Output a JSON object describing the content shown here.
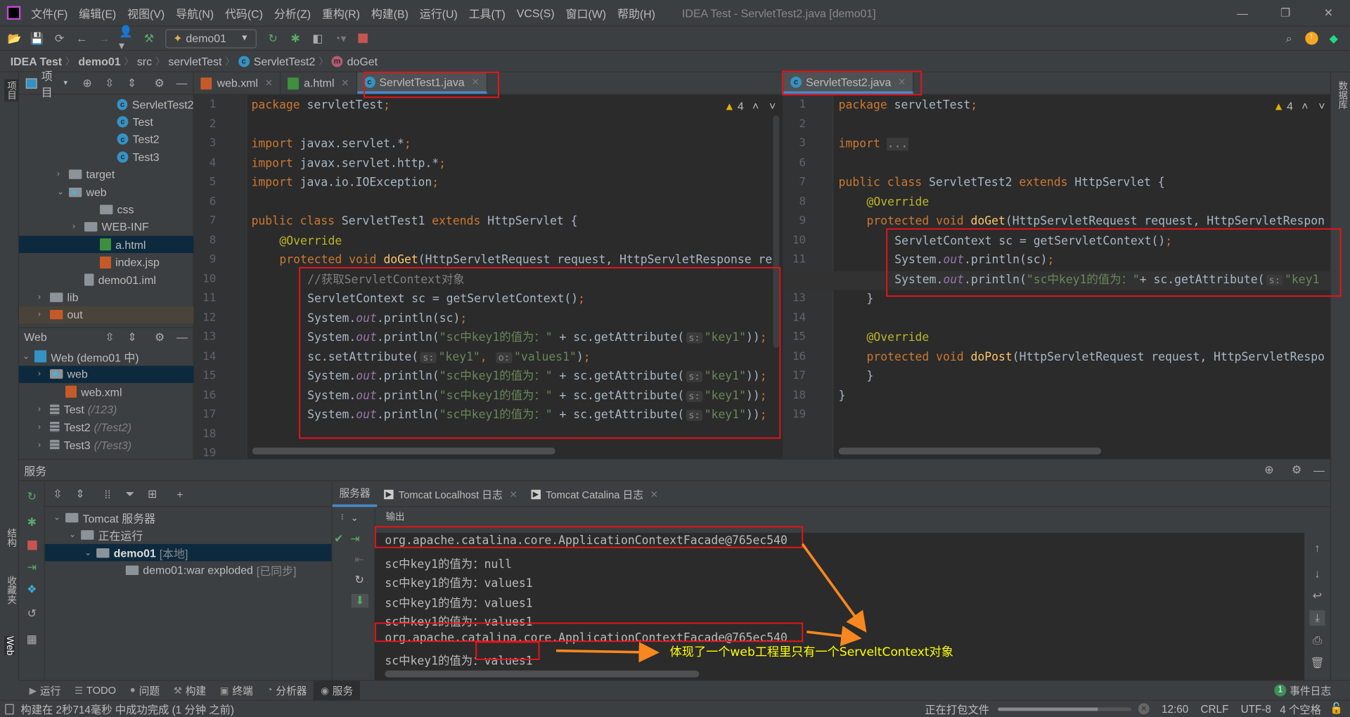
{
  "menu": [
    "文件(F)",
    "编辑(E)",
    "视图(V)",
    "导航(N)",
    "代码(C)",
    "分析(Z)",
    "重构(R)",
    "构建(B)",
    "运行(U)",
    "工具(T)",
    "VCS(S)",
    "窗口(W)",
    "帮助(H)"
  ],
  "window_title": "IDEA Test - ServletTest2.java [demo01]",
  "toolbar": {
    "run_config": "demo01"
  },
  "breadcrumb": [
    "IDEA Test",
    "demo01",
    "src",
    "servletTest",
    "ServletTest2",
    "doGet"
  ],
  "left_strip": {
    "project": "项目",
    "structure": "结构",
    "favorites": "收藏夹",
    "web": "Web"
  },
  "right_strip": {
    "database": "数据库"
  },
  "project_panel": {
    "title": "项目",
    "items": [
      {
        "label": "ServletTest2",
        "icon": "class-icon",
        "indent": 100
      },
      {
        "label": "Test",
        "icon": "class-icon",
        "indent": 100
      },
      {
        "label": "Test2",
        "icon": "class-icon",
        "indent": 100
      },
      {
        "label": "Test3",
        "icon": "class-icon",
        "indent": 100
      },
      {
        "label": "target",
        "icon": "folder-icon",
        "indent": 44,
        "arrow": "›"
      },
      {
        "label": "web",
        "icon": "web-folder-icon",
        "indent": 44,
        "arrow": "⌄"
      },
      {
        "label": "css",
        "icon": "folder-icon",
        "indent": 80
      },
      {
        "label": "WEB-INF",
        "icon": "folder-icon",
        "indent": 62,
        "arrow": "›"
      },
      {
        "label": "a.html",
        "icon": "html-file-icon",
        "indent": 80,
        "selected": true
      },
      {
        "label": "index.jsp",
        "icon": "jsp-file-icon",
        "indent": 80
      },
      {
        "label": "demo01.iml",
        "icon": "iml-file-icon",
        "indent": 62
      },
      {
        "label": "lib",
        "icon": "folder-icon",
        "indent": 22,
        "arrow": "›"
      },
      {
        "label": "out",
        "icon": "orange-folder-icon",
        "indent": 22,
        "arrow": "›",
        "highlight": true
      }
    ]
  },
  "web_panel": {
    "title": "Web",
    "items": [
      {
        "label": "Web (demo01 中)",
        "icon": "web-module-icon",
        "indent": 4,
        "arrow": "⌄"
      },
      {
        "label": "web",
        "icon": "web-folder-icon",
        "indent": 22,
        "arrow": "›",
        "selected": true
      },
      {
        "label": "web.xml",
        "icon": "xml-file-icon",
        "indent": 40
      },
      {
        "label": "Test",
        "hint": "(/123)",
        "icon": "servlet-icon",
        "indent": 22,
        "arrow": "›"
      },
      {
        "label": "Test2",
        "hint": "(/Test2)",
        "icon": "servlet-icon",
        "indent": 22,
        "arrow": "›"
      },
      {
        "label": "Test3",
        "hint": "(/Test3)",
        "icon": "servlet-icon",
        "indent": 22,
        "arrow": "›"
      }
    ]
  },
  "editor1": {
    "tabs": [
      {
        "label": "web.xml"
      },
      {
        "label": "a.html"
      },
      {
        "label": "ServletTest1.java",
        "active": true
      }
    ],
    "warnings": "4",
    "lines": [
      {
        "n": "1",
        "i": 0,
        "t": [
          [
            "package ",
            "kw"
          ],
          [
            "servletTest",
            "pl"
          ],
          [
            ";",
            "kw"
          ]
        ]
      },
      {
        "n": "2",
        "i": 0,
        "t": []
      },
      {
        "n": "3",
        "i": 0,
        "t": [
          [
            "import ",
            "kw"
          ],
          [
            "javax.servlet.*",
            "pl"
          ],
          [
            ";",
            "kw"
          ]
        ]
      },
      {
        "n": "4",
        "i": 0,
        "t": [
          [
            "import ",
            "kw"
          ],
          [
            "javax.servlet.http.*",
            "pl"
          ],
          [
            ";",
            "kw"
          ]
        ]
      },
      {
        "n": "5",
        "i": 0,
        "t": [
          [
            "import ",
            "kw"
          ],
          [
            "java.io.IOException",
            "pl"
          ],
          [
            ";",
            "kw"
          ]
        ]
      },
      {
        "n": "6",
        "i": 0,
        "t": []
      },
      {
        "n": "7",
        "i": 0,
        "t": [
          [
            "public class ",
            "kw"
          ],
          [
            "ServletTest1 ",
            "pl"
          ],
          [
            "extends ",
            "kw"
          ],
          [
            "HttpServlet {",
            "pl"
          ]
        ]
      },
      {
        "n": "8",
        "i": 1,
        "t": [
          [
            "@Override",
            "ann"
          ]
        ]
      },
      {
        "n": "9",
        "i": 1,
        "t": [
          [
            "protected void ",
            "kw"
          ],
          [
            "doGet",
            "mth"
          ],
          [
            "(HttpServletRequest request, HttpServletResponse res",
            "pl"
          ]
        ]
      },
      {
        "n": "10",
        "i": 2,
        "t": [
          [
            "//获取ServletContext对象",
            "cm"
          ]
        ]
      },
      {
        "n": "11",
        "i": 2,
        "t": [
          [
            "ServletContext sc = getServletContext()",
            "pl"
          ],
          [
            ";",
            "kw"
          ]
        ]
      },
      {
        "n": "12",
        "i": 2,
        "t": [
          [
            "System.",
            "pl"
          ],
          [
            "out",
            "fld"
          ],
          [
            ".println(sc)",
            "pl"
          ],
          [
            ";",
            "kw"
          ]
        ]
      },
      {
        "n": "13",
        "i": 2,
        "t": [
          [
            "System.",
            "pl"
          ],
          [
            "out",
            "fld"
          ],
          [
            ".println(",
            "pl"
          ],
          [
            "\"sc中key1的值为：\"",
            "str"
          ],
          [
            " + sc.getAttribute(",
            "pl"
          ],
          [
            "s:",
            "hint"
          ],
          [
            "\"key1\"",
            "str"
          ],
          [
            "))",
            "pl"
          ],
          [
            ";",
            "kw"
          ]
        ]
      },
      {
        "n": "14",
        "i": 2,
        "t": [
          [
            "sc.setAttribute(",
            "pl"
          ],
          [
            "s:",
            "hint"
          ],
          [
            "\"key1\"",
            "str"
          ],
          [
            ", ",
            "kw"
          ],
          [
            "o:",
            "hint"
          ],
          [
            "\"values1\"",
            "str"
          ],
          [
            ")",
            "pl"
          ],
          [
            ";",
            "kw"
          ]
        ]
      },
      {
        "n": "15",
        "i": 2,
        "t": [
          [
            "System.",
            "pl"
          ],
          [
            "out",
            "fld"
          ],
          [
            ".println(",
            "pl"
          ],
          [
            "\"sc中key1的值为：\"",
            "str"
          ],
          [
            " + sc.getAttribute(",
            "pl"
          ],
          [
            "s:",
            "hint"
          ],
          [
            "\"key1\"",
            "str"
          ],
          [
            "))",
            "pl"
          ],
          [
            ";",
            "kw"
          ]
        ]
      },
      {
        "n": "16",
        "i": 2,
        "t": [
          [
            "System.",
            "pl"
          ],
          [
            "out",
            "fld"
          ],
          [
            ".println(",
            "pl"
          ],
          [
            "\"sc中key1的值为：\"",
            "str"
          ],
          [
            " + sc.getAttribute(",
            "pl"
          ],
          [
            "s:",
            "hint"
          ],
          [
            "\"key1\"",
            "str"
          ],
          [
            "))",
            "pl"
          ],
          [
            ";",
            "kw"
          ]
        ]
      },
      {
        "n": "17",
        "i": 2,
        "t": [
          [
            "System.",
            "pl"
          ],
          [
            "out",
            "fld"
          ],
          [
            ".println(",
            "pl"
          ],
          [
            "\"sc中key1的值为：\"",
            "str"
          ],
          [
            " + sc.getAttribute(",
            "pl"
          ],
          [
            "s:",
            "hint"
          ],
          [
            "\"key1\"",
            "str"
          ],
          [
            "))",
            "pl"
          ],
          [
            ";",
            "kw"
          ]
        ]
      },
      {
        "n": "18",
        "i": 0,
        "t": []
      },
      {
        "n": "19",
        "i": 0,
        "t": []
      }
    ]
  },
  "editor2": {
    "tabs": [
      {
        "label": "ServletTest2.java",
        "active": true
      }
    ],
    "warnings": "4",
    "lines": [
      {
        "n": "1",
        "i": 0,
        "t": [
          [
            "package ",
            "kw"
          ],
          [
            "servletTest",
            "pl"
          ],
          [
            ";",
            "kw"
          ]
        ]
      },
      {
        "n": "2",
        "i": 0,
        "t": []
      },
      {
        "n": "3",
        "i": 0,
        "t": [
          [
            "import ",
            "kw"
          ],
          [
            "...",
            "fh"
          ]
        ]
      },
      {
        "n": "6",
        "i": 0,
        "t": []
      },
      {
        "n": "7",
        "i": 0,
        "t": [
          [
            "public class ",
            "kw"
          ],
          [
            "ServletTest2 ",
            "pl"
          ],
          [
            "extends ",
            "kw"
          ],
          [
            "HttpServlet {",
            "pl"
          ]
        ]
      },
      {
        "n": "8",
        "i": 1,
        "t": [
          [
            "@Override",
            "ann"
          ]
        ]
      },
      {
        "n": "9",
        "i": 1,
        "t": [
          [
            "protected void ",
            "kw"
          ],
          [
            "doGet",
            "mth"
          ],
          [
            "(HttpServletRequest request, HttpServletRespon",
            "pl"
          ]
        ]
      },
      {
        "n": "10",
        "i": 2,
        "t": [
          [
            "ServletContext sc = getServletContext()",
            "pl"
          ],
          [
            ";",
            "kw"
          ]
        ]
      },
      {
        "n": "11",
        "i": 2,
        "t": [
          [
            "System.",
            "pl"
          ],
          [
            "out",
            "fld"
          ],
          [
            ".println(sc)",
            "pl"
          ],
          [
            ";",
            "kw"
          ]
        ]
      },
      {
        "n": "12",
        "i": 2,
        "t": [
          [
            "System.",
            "pl"
          ],
          [
            "out",
            "fld"
          ],
          [
            ".println(",
            "pl"
          ],
          [
            "\"sc中key1的值为：\"",
            "str"
          ],
          [
            "+ sc.getAttribute(",
            "pl"
          ],
          [
            "s:",
            "hint"
          ],
          [
            "\"key1",
            "str"
          ]
        ]
      },
      {
        "n": "13",
        "i": 1,
        "t": [
          [
            "}",
            "pl"
          ]
        ]
      },
      {
        "n": "14",
        "i": 0,
        "t": []
      },
      {
        "n": "15",
        "i": 1,
        "t": [
          [
            "@Override",
            "ann"
          ]
        ]
      },
      {
        "n": "16",
        "i": 1,
        "t": [
          [
            "protected void ",
            "kw"
          ],
          [
            "doPost",
            "mth"
          ],
          [
            "(HttpServletRequest request, HttpServletRespo",
            "pl"
          ]
        ]
      },
      {
        "n": "17",
        "i": 1,
        "t": [
          [
            "}",
            "pl"
          ]
        ]
      },
      {
        "n": "18",
        "i": 0,
        "t": [
          [
            "}",
            "pl"
          ]
        ]
      },
      {
        "n": "19",
        "i": 0,
        "t": []
      }
    ]
  },
  "services": {
    "title": "服务",
    "tree": [
      {
        "label": "Tomcat 服务器",
        "indent": 10,
        "arrow": "⌄",
        "icon": "tomcat-icon"
      },
      {
        "label": "正在运行",
        "indent": 28,
        "arrow": "⌄",
        "icon": "running-icon"
      },
      {
        "label": "demo01",
        "extra": "[本地]",
        "indent": 46,
        "arrow": "⌄",
        "icon": "tomcat-icon",
        "selected": true
      },
      {
        "label": "demo01:war exploded",
        "extra": "[已同步]",
        "indent": 80,
        "icon": "artifact-icon"
      }
    ],
    "tabs": [
      {
        "label": "服务器",
        "active": true
      },
      {
        "label": "Tomcat Localhost 日志"
      },
      {
        "label": "Tomcat Catalina 日志"
      }
    ],
    "output_label": "输出",
    "output": [
      "org.apache.catalina.core.ApplicationContextFacade@765ec540",
      "sc中key1的值为：null",
      "sc中key1的值为：values1",
      "sc中key1的值为：values1",
      "sc中key1的值为：values1",
      "org.apache.catalina.core.ApplicationContextFacade@765ec540",
      "sc中key1的值为：values1"
    ]
  },
  "annotation": "体现了一个web工程里只有一个ServeltContext对象",
  "bottom_tools": [
    {
      "label": "运行",
      "icon": "run-icon"
    },
    {
      "label": "TODO",
      "icon": "todo-icon"
    },
    {
      "label": "问题",
      "icon": "problems-icon"
    },
    {
      "label": "构建",
      "icon": "build-icon"
    },
    {
      "label": "终端",
      "icon": "terminal-icon"
    },
    {
      "label": "分析器",
      "icon": "profiler-icon"
    },
    {
      "label": "服务",
      "icon": "services-icon",
      "active": true
    }
  ],
  "event_log": {
    "count": "1",
    "label": "事件日志"
  },
  "status": {
    "message": "构建在 2秒714毫秒 中成功完成 (1 分钟 之前)",
    "task": "正在打包文件",
    "task_progress": 0.75,
    "position": "12:60",
    "line_sep": "CRLF",
    "encoding": "UTF-8",
    "indent": "4 个空格"
  },
  "colors": {
    "keyword": "#cc7832",
    "string": "#6a8759",
    "annotation_box": "#e8131b",
    "arrow": "#f7871f",
    "note": "#ffff00"
  }
}
